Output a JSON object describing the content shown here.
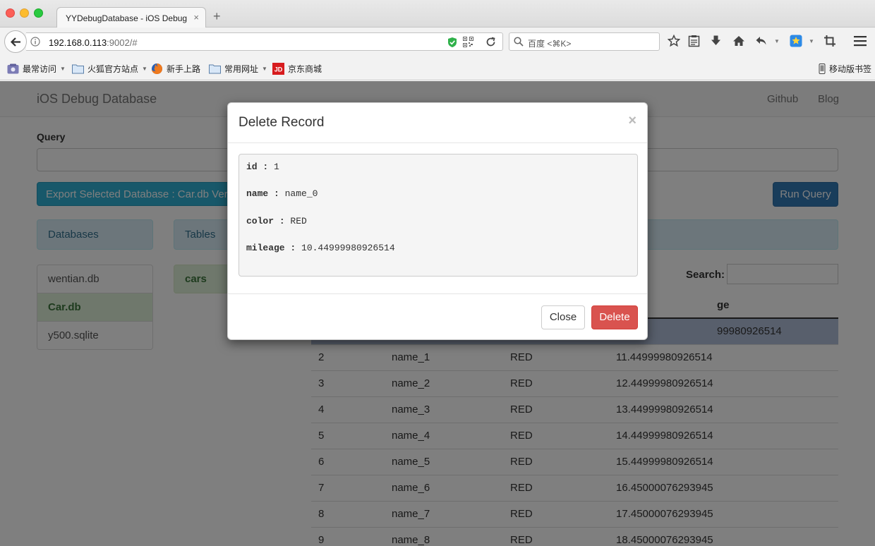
{
  "browser": {
    "tab_title": "YYDebugDatabase - iOS Debug D",
    "tab_close": "×",
    "new_tab": "+",
    "url_host": "192.168.0.113",
    "url_path": ":9002/#",
    "search_placeholder": "百度 <⌘K>",
    "bookmarks": [
      {
        "label": "最常访问",
        "icon": "most-visited-icon",
        "caret": "▼"
      },
      {
        "label": "火狐官方站点",
        "icon": "folder-icon",
        "caret": "▼"
      },
      {
        "label": "新手上路",
        "icon": "firefox-icon"
      },
      {
        "label": "常用网址",
        "icon": "folder-icon",
        "caret": "▼"
      },
      {
        "label": "京东商城",
        "icon": "jd-icon",
        "icon_text": "JD"
      }
    ],
    "mobile_bookmarks": "移动版书签",
    "toolbar_caret": "▼"
  },
  "site": {
    "brand": "iOS Debug Database",
    "nav": [
      "Github",
      "Blog"
    ],
    "query_label": "Query",
    "export_label": "Export Selected Database : Car.db Version",
    "run_label": "Run Query",
    "databases_header": "Databases",
    "tables_header": "Tables",
    "databases": [
      "wentian.db",
      "Car.db",
      "y500.sqlite"
    ],
    "active_database": "Car.db",
    "tables": [
      "cars"
    ],
    "search_label": "Search:",
    "columns": [
      "",
      "",
      "",
      "ge"
    ],
    "rows": [
      [
        "",
        "",
        "",
        "99980926514"
      ],
      [
        "2",
        "name_1",
        "RED",
        "11.44999980926514"
      ],
      [
        "3",
        "name_2",
        "RED",
        "12.44999980926514"
      ],
      [
        "4",
        "name_3",
        "RED",
        "13.44999980926514"
      ],
      [
        "5",
        "name_4",
        "RED",
        "14.44999980926514"
      ],
      [
        "6",
        "name_5",
        "RED",
        "15.44999980926514"
      ],
      [
        "7",
        "name_6",
        "RED",
        "16.45000076293945"
      ],
      [
        "8",
        "name_7",
        "RED",
        "17.45000076293945"
      ],
      [
        "9",
        "name_8",
        "RED",
        "18.45000076293945"
      ]
    ]
  },
  "modal": {
    "title": "Delete Record",
    "close_x": "×",
    "fields": [
      {
        "key": "id",
        "sep": " : ",
        "value": "1"
      },
      {
        "key": "name",
        "sep": " : ",
        "value": "name_0"
      },
      {
        "key": "color",
        "sep": " : ",
        "value": "RED"
      },
      {
        "key": "mileage",
        "sep": " : ",
        "value": "10.44999980926514"
      }
    ],
    "close_label": "Close",
    "delete_label": "Delete"
  },
  "colors": {
    "danger": "#d9534f",
    "primary": "#337ab7",
    "info": "#31b0d5",
    "success_bg": "#dff0d8",
    "selected_row": "#b0bed9"
  }
}
